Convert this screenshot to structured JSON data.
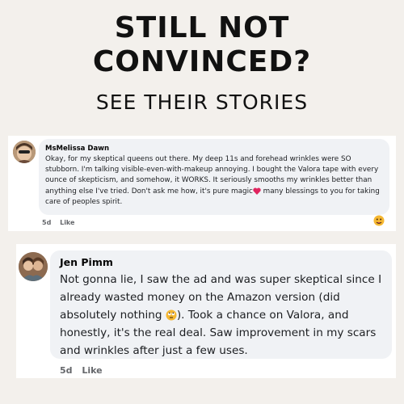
{
  "header": {
    "title_line1": "STILL NOT",
    "title_line2": "CONVINCED?",
    "subtitle": "SEE THEIR STORIES"
  },
  "comments": [
    {
      "author": "MsMelissa Dawn",
      "text_before_emoji": "Okay, for my skeptical queens out there. My deep 11s and forehead wrinkles were SO stubborn. I'm talking visible-even-with-makeup annoying. I bought the Valora tape with every ounce of skepticism, and somehow, it WORKS. It seriously smooths my wrinkles better than anything else I've tried. Don't ask me how, it's pure magic",
      "inline_emoji": "heart-icon",
      "text_after_emoji": " many blessings to you for taking care of peoples spirit.",
      "time": "5d",
      "like_label": "Like",
      "reaction_emoji": "face-emoji-icon",
      "colors": {
        "heart": "#e0245e",
        "reaction": "#f5b731"
      }
    },
    {
      "author": "Jen Pimm",
      "text_before_emoji": "Not gonna lie, I saw the ad and was super skeptical since I already wasted money on the Amazon version (did absolutely nothing ",
      "inline_emoji": "eye-roll-emoji-icon",
      "text_after_emoji": "). Took a chance on Valora, and honestly, it's the real deal. Saw improvement in my scars and wrinkles after just a few uses.",
      "time": "5d",
      "like_label": "Like",
      "colors": {
        "emoji": "#f5b731"
      }
    }
  ],
  "colors": {
    "background": "#f3f0ec",
    "card": "#ffffff",
    "bubble": "#f0f2f5",
    "meta_text": "#65676b"
  }
}
